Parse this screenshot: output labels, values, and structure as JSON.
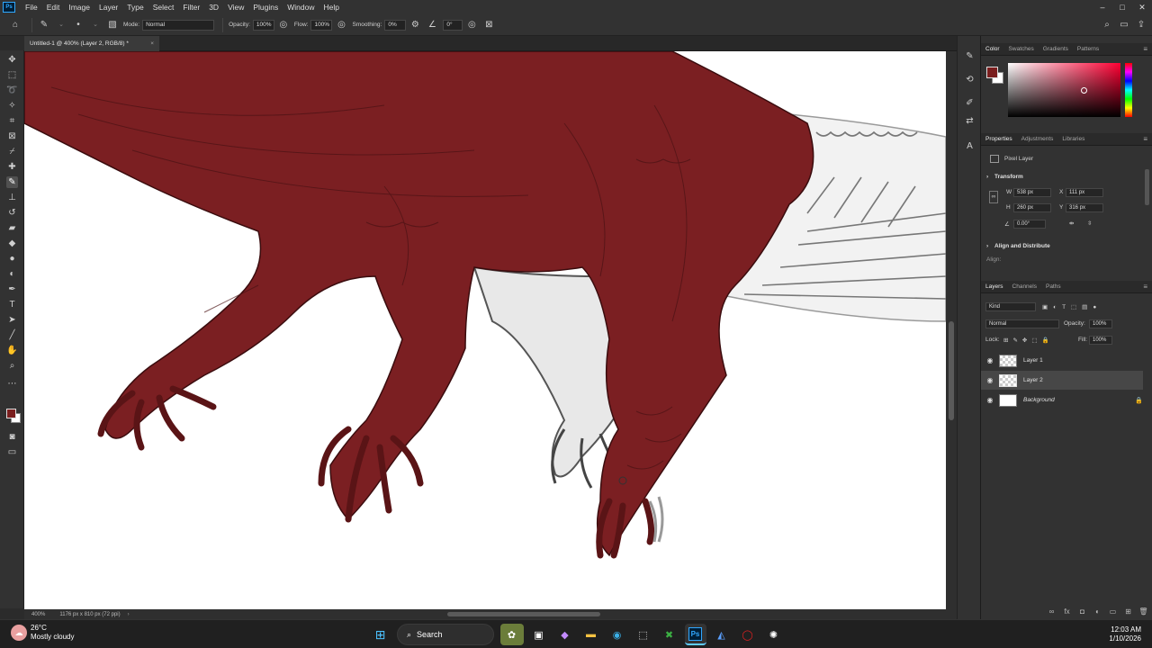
{
  "app": {
    "menu": [
      "File",
      "Edit",
      "Image",
      "Layer",
      "Type",
      "Select",
      "Filter",
      "3D",
      "View",
      "Plugins",
      "Window",
      "Help"
    ]
  },
  "options": {
    "mode_label": "Mode:",
    "mode_value": "Normal",
    "opacity_label": "Opacity:",
    "opacity_value": "100%",
    "flow_label": "Flow:",
    "flow_value": "100%",
    "smoothing_label": "Smoothing:",
    "smoothing_value": "0%",
    "angle_value": "0°"
  },
  "document": {
    "tab_title": "Untitled-1 @ 400% (Layer 2, RGB/8) *",
    "zoom": "400%",
    "dimensions": "1176 px x 810 px (72 ppi)"
  },
  "color_panel": {
    "tabs": [
      "Color",
      "Swatches",
      "Gradients",
      "Patterns"
    ],
    "foreground": "#7a1e1e",
    "background": "#ffffff"
  },
  "properties_panel": {
    "tabs": [
      "Properties",
      "Adjustments",
      "Libraries"
    ],
    "layer_type": "Pixel Layer",
    "transform_title": "Transform",
    "w_label": "W",
    "w_value": "538 px",
    "x_label": "X",
    "x_value": "111 px",
    "h_label": "H",
    "h_value": "260 px",
    "y_label": "Y",
    "y_value": "316 px",
    "angle_value": "0.00°",
    "align_title": "Align and Distribute",
    "align_label": "Align:"
  },
  "layers_panel": {
    "tabs": [
      "Layers",
      "Channels",
      "Paths"
    ],
    "filter_kind": "Kind",
    "blend_mode": "Normal",
    "opacity_label": "Opacity:",
    "opacity_value": "100%",
    "lock_label": "Lock:",
    "fill_label": "Fill:",
    "fill_value": "100%",
    "layers": [
      {
        "name": "Layer 1"
      },
      {
        "name": "Layer 2"
      },
      {
        "name": "Background"
      }
    ]
  },
  "taskbar": {
    "temperature": "26°C",
    "weather": "Mostly cloudy",
    "search_label": "Search",
    "time": "12:03 AM",
    "date": "1/10/2026"
  }
}
